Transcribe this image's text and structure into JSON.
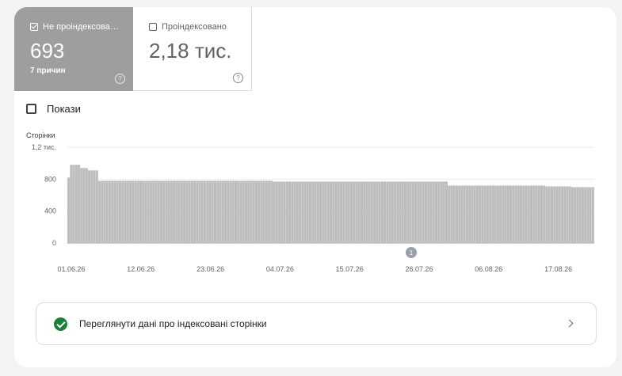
{
  "tabs": [
    {
      "label": "Не проіндексова…",
      "value": "693",
      "sub": "7 причин",
      "checked": true
    },
    {
      "label": "Проіндексовано",
      "value": "2,18 тис.",
      "checked": false
    }
  ],
  "impressions_toggle": {
    "label": "Покази",
    "checked": false
  },
  "annotation_marker": "1",
  "link_row": {
    "label": "Переглянути дані про індексовані сторінки"
  },
  "colors": {
    "bar": "#bdbdbd",
    "active_tab": "#9e9e9e",
    "success": "#188038"
  },
  "chart_data": {
    "type": "bar",
    "ylabel": "Сторінки",
    "ylim": [
      0,
      1200
    ],
    "y_ticks": [
      0,
      400,
      800,
      1200
    ],
    "y_tick_labels": [
      "0",
      "400",
      "800",
      "1,2 тис."
    ],
    "grid": true,
    "x_tick_labels": [
      "01.06.26",
      "12.06.26",
      "23.06.26",
      "04.07.26",
      "15.07.26",
      "26.07.26",
      "06.08.26",
      "17.08.26"
    ],
    "values": [
      820,
      980,
      980,
      980,
      980,
      940,
      940,
      940,
      910,
      910,
      910,
      910,
      780,
      780,
      780,
      780,
      780,
      780,
      780,
      780,
      780,
      780,
      780,
      780,
      780,
      780,
      780,
      780,
      780,
      780,
      780,
      780,
      780,
      780,
      780,
      780,
      780,
      780,
      780,
      780,
      780,
      780,
      780,
      780,
      780,
      780,
      780,
      780,
      780,
      780,
      780,
      780,
      780,
      780,
      780,
      780,
      780,
      780,
      780,
      780,
      780,
      780,
      780,
      780,
      780,
      780,
      780,
      780,
      780,
      780,
      780,
      780,
      780,
      780,
      780,
      780,
      780,
      780,
      780,
      780,
      770,
      770,
      770,
      770,
      770,
      770,
      770,
      770,
      770,
      770,
      770,
      770,
      770,
      770,
      770,
      770,
      770,
      770,
      770,
      770,
      770,
      770,
      770,
      770,
      770,
      770,
      770,
      770,
      770,
      770,
      770,
      770,
      770,
      770,
      770,
      770,
      770,
      770,
      770,
      770,
      770,
      770,
      770,
      770,
      770,
      770,
      770,
      770,
      770,
      770,
      770,
      770,
      770,
      770,
      770,
      770,
      770,
      770,
      770,
      770,
      770,
      770,
      770,
      770,
      770,
      770,
      770,
      770,
      720,
      720,
      720,
      720,
      720,
      720,
      720,
      720,
      720,
      720,
      720,
      720,
      720,
      720,
      720,
      720,
      720,
      720,
      720,
      720,
      720,
      720,
      720,
      720,
      720,
      720,
      720,
      720,
      720,
      720,
      720,
      720,
      720,
      720,
      720,
      720,
      720,
      720,
      710,
      710,
      710,
      710,
      710,
      710,
      710,
      710,
      710,
      710,
      700,
      700,
      700,
      700,
      700,
      700,
      700,
      700,
      700
    ]
  }
}
